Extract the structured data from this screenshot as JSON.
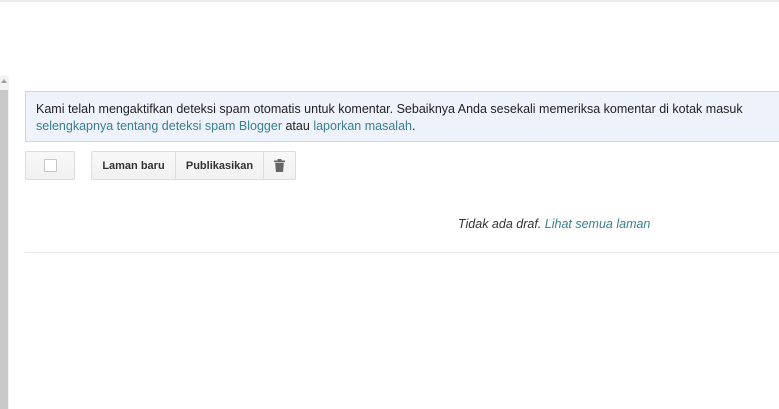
{
  "notice": {
    "text_before": "Kami telah mengaktifkan deteksi spam otomatis untuk komentar. Sebaiknya Anda sesekali memeriksa komentar di kotak masuk",
    "link_learn_more": "selengkapnya tentang deteksi spam Blogger",
    "text_between": "atau",
    "link_report": "laporkan masalah",
    "text_after": "."
  },
  "toolbar": {
    "new_page_label": "Laman baru",
    "publish_label": "Publikasikan",
    "delete_icon": "trash-icon"
  },
  "empty_state": {
    "message": "Tidak ada draf.",
    "link_all_pages": "Lihat semua laman"
  },
  "colors": {
    "link": "#3b7e8f",
    "notice_background": "#eef3fb"
  }
}
